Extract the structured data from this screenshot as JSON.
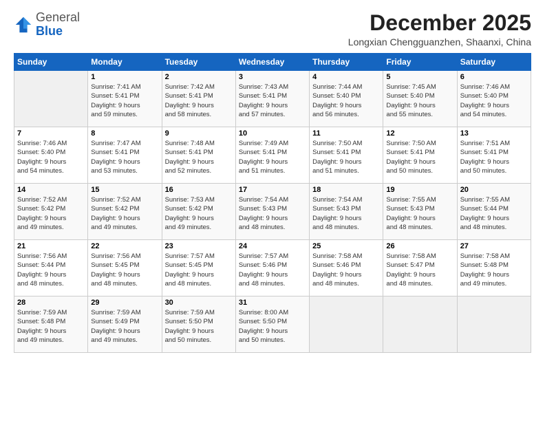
{
  "logo": {
    "general": "General",
    "blue": "Blue"
  },
  "title": "December 2025",
  "location": "Longxian Chengguanzhen, Shaanxi, China",
  "days_header": [
    "Sunday",
    "Monday",
    "Tuesday",
    "Wednesday",
    "Thursday",
    "Friday",
    "Saturday"
  ],
  "weeks": [
    [
      {
        "num": "",
        "info": ""
      },
      {
        "num": "1",
        "info": "Sunrise: 7:41 AM\nSunset: 5:41 PM\nDaylight: 9 hours\nand 59 minutes."
      },
      {
        "num": "2",
        "info": "Sunrise: 7:42 AM\nSunset: 5:41 PM\nDaylight: 9 hours\nand 58 minutes."
      },
      {
        "num": "3",
        "info": "Sunrise: 7:43 AM\nSunset: 5:41 PM\nDaylight: 9 hours\nand 57 minutes."
      },
      {
        "num": "4",
        "info": "Sunrise: 7:44 AM\nSunset: 5:40 PM\nDaylight: 9 hours\nand 56 minutes."
      },
      {
        "num": "5",
        "info": "Sunrise: 7:45 AM\nSunset: 5:40 PM\nDaylight: 9 hours\nand 55 minutes."
      },
      {
        "num": "6",
        "info": "Sunrise: 7:46 AM\nSunset: 5:40 PM\nDaylight: 9 hours\nand 54 minutes."
      }
    ],
    [
      {
        "num": "7",
        "info": "Sunrise: 7:46 AM\nSunset: 5:40 PM\nDaylight: 9 hours\nand 54 minutes."
      },
      {
        "num": "8",
        "info": "Sunrise: 7:47 AM\nSunset: 5:41 PM\nDaylight: 9 hours\nand 53 minutes."
      },
      {
        "num": "9",
        "info": "Sunrise: 7:48 AM\nSunset: 5:41 PM\nDaylight: 9 hours\nand 52 minutes."
      },
      {
        "num": "10",
        "info": "Sunrise: 7:49 AM\nSunset: 5:41 PM\nDaylight: 9 hours\nand 51 minutes."
      },
      {
        "num": "11",
        "info": "Sunrise: 7:50 AM\nSunset: 5:41 PM\nDaylight: 9 hours\nand 51 minutes."
      },
      {
        "num": "12",
        "info": "Sunrise: 7:50 AM\nSunset: 5:41 PM\nDaylight: 9 hours\nand 50 minutes."
      },
      {
        "num": "13",
        "info": "Sunrise: 7:51 AM\nSunset: 5:41 PM\nDaylight: 9 hours\nand 50 minutes."
      }
    ],
    [
      {
        "num": "14",
        "info": "Sunrise: 7:52 AM\nSunset: 5:42 PM\nDaylight: 9 hours\nand 49 minutes."
      },
      {
        "num": "15",
        "info": "Sunrise: 7:52 AM\nSunset: 5:42 PM\nDaylight: 9 hours\nand 49 minutes."
      },
      {
        "num": "16",
        "info": "Sunrise: 7:53 AM\nSunset: 5:42 PM\nDaylight: 9 hours\nand 49 minutes."
      },
      {
        "num": "17",
        "info": "Sunrise: 7:54 AM\nSunset: 5:43 PM\nDaylight: 9 hours\nand 48 minutes."
      },
      {
        "num": "18",
        "info": "Sunrise: 7:54 AM\nSunset: 5:43 PM\nDaylight: 9 hours\nand 48 minutes."
      },
      {
        "num": "19",
        "info": "Sunrise: 7:55 AM\nSunset: 5:43 PM\nDaylight: 9 hours\nand 48 minutes."
      },
      {
        "num": "20",
        "info": "Sunrise: 7:55 AM\nSunset: 5:44 PM\nDaylight: 9 hours\nand 48 minutes."
      }
    ],
    [
      {
        "num": "21",
        "info": "Sunrise: 7:56 AM\nSunset: 5:44 PM\nDaylight: 9 hours\nand 48 minutes."
      },
      {
        "num": "22",
        "info": "Sunrise: 7:56 AM\nSunset: 5:45 PM\nDaylight: 9 hours\nand 48 minutes."
      },
      {
        "num": "23",
        "info": "Sunrise: 7:57 AM\nSunset: 5:45 PM\nDaylight: 9 hours\nand 48 minutes."
      },
      {
        "num": "24",
        "info": "Sunrise: 7:57 AM\nSunset: 5:46 PM\nDaylight: 9 hours\nand 48 minutes."
      },
      {
        "num": "25",
        "info": "Sunrise: 7:58 AM\nSunset: 5:46 PM\nDaylight: 9 hours\nand 48 minutes."
      },
      {
        "num": "26",
        "info": "Sunrise: 7:58 AM\nSunset: 5:47 PM\nDaylight: 9 hours\nand 48 minutes."
      },
      {
        "num": "27",
        "info": "Sunrise: 7:58 AM\nSunset: 5:48 PM\nDaylight: 9 hours\nand 49 minutes."
      }
    ],
    [
      {
        "num": "28",
        "info": "Sunrise: 7:59 AM\nSunset: 5:48 PM\nDaylight: 9 hours\nand 49 minutes."
      },
      {
        "num": "29",
        "info": "Sunrise: 7:59 AM\nSunset: 5:49 PM\nDaylight: 9 hours\nand 49 minutes."
      },
      {
        "num": "30",
        "info": "Sunrise: 7:59 AM\nSunset: 5:50 PM\nDaylight: 9 hours\nand 50 minutes."
      },
      {
        "num": "31",
        "info": "Sunrise: 8:00 AM\nSunset: 5:50 PM\nDaylight: 9 hours\nand 50 minutes."
      },
      {
        "num": "",
        "info": ""
      },
      {
        "num": "",
        "info": ""
      },
      {
        "num": "",
        "info": ""
      }
    ]
  ]
}
